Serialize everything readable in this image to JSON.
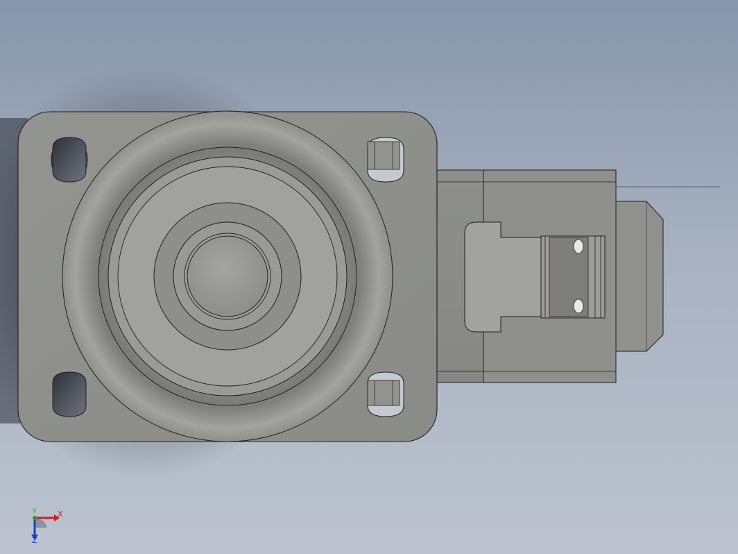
{
  "viewport": {
    "background_top": "#8796ab",
    "background_bottom": "#bcc3cf",
    "model_color": "#8e8f8a",
    "edge_color": "#1e1e1e"
  },
  "triad": {
    "x_label": "X",
    "y_label": "Y",
    "z_label": "Z",
    "x_color": "#d21e1e",
    "y_color": "#1fa31f",
    "z_color": "#1e3cc8"
  }
}
